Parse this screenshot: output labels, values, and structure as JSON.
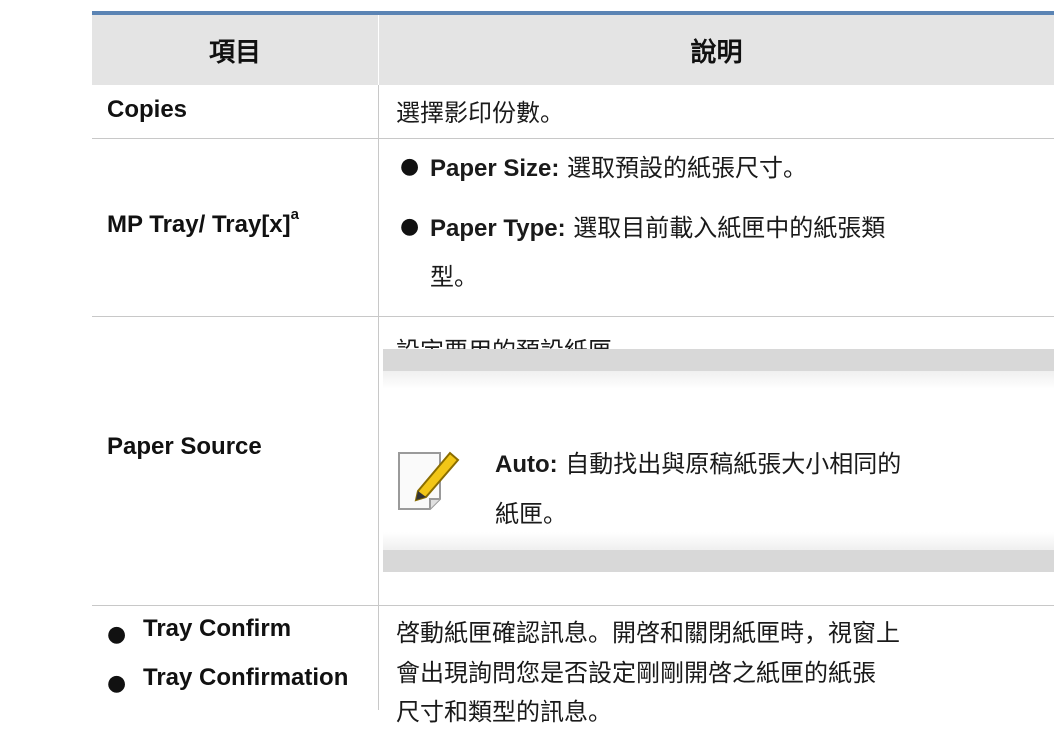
{
  "table": {
    "header": {
      "item": "項目",
      "desc": "說明"
    },
    "rows": [
      {
        "item": "Copies",
        "desc": "選擇影印份數。"
      },
      {
        "item": "MP Tray/ Tray[x]",
        "item_sup": "a",
        "bullets": [
          {
            "term": "Paper Size:",
            "text": "選取預設的紙張尺寸。"
          },
          {
            "term": "Paper Type:",
            "text_line1": "選取目前載入紙匣中的紙張類",
            "text_line2": "型。"
          }
        ]
      },
      {
        "item": "Paper Source",
        "desc": "設定要用的預設紙匣。",
        "note": {
          "term": "Auto:",
          "text_line1": "自動找出與原稿紙張大小相同的",
          "text_line2": "紙匣。"
        }
      },
      {
        "items": [
          "Tray Confirm",
          "Tray Confirmation"
        ],
        "desc_lines": [
          "啓動紙匣確認訊息。開啓和關閉紙匣時，視窗上",
          "會出現詢問您是否設定剛剛開啓之紙匣的紙張",
          "尺寸和類型的訊息。"
        ]
      }
    ]
  },
  "icons": {
    "note": "note-pencil-icon",
    "bullet": "bullet-dot-icon"
  },
  "colors": {
    "header_rule": "#5b84b4",
    "header_bg": "#e4e4e4",
    "grid": "#c8c8c8",
    "note_band": "#d8d8d8"
  }
}
